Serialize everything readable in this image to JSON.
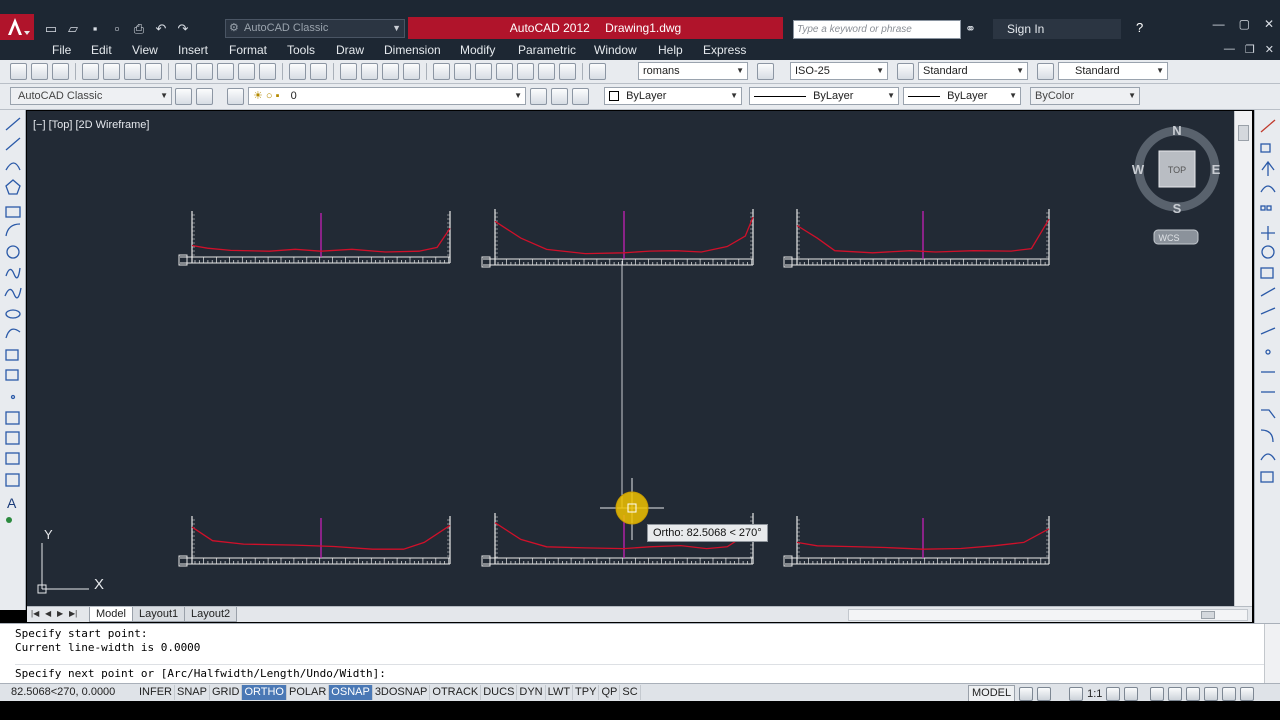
{
  "app": {
    "title_app": "AutoCAD 2012",
    "title_file": "Drawing1.dwg",
    "workspace": "AutoCAD Classic",
    "search_placeholder": "Type a keyword or phrase",
    "sign_in": "Sign In"
  },
  "menu": [
    "File",
    "Edit",
    "View",
    "Insert",
    "Format",
    "Tools",
    "Draw",
    "Dimension",
    "Modify",
    "Parametric",
    "Window",
    "Help",
    "Express"
  ],
  "toolbar1": {
    "text_style": "romans",
    "dim_style": "ISO-25",
    "table_style": "Standard",
    "mleader_style": "Standard"
  },
  "toolbar2": {
    "workspace": "AutoCAD Classic",
    "layer": "0",
    "color": "ByLayer",
    "linetype": "ByLayer",
    "lineweight": "ByLayer",
    "plotstyle": "ByColor"
  },
  "viewport": {
    "label": "[−] [Top] [2D Wireframe]"
  },
  "viewcube": {
    "north": "N",
    "south": "S",
    "east": "E",
    "west": "W",
    "face": "TOP",
    "ucs": "WCS"
  },
  "ucs_icon": {
    "x": "X",
    "y": "Y"
  },
  "tooltip": "Ortho: 82.5068 < 270°",
  "tabs": [
    "Model",
    "Layout1",
    "Layout2"
  ],
  "command": {
    "history": [
      "Specify start point:",
      "Current line-width is 0.0000"
    ],
    "prompt": "Specify next point or [Arc/Halfwidth/Length/Undo/Width]:"
  },
  "status": {
    "coords": "82.5068<270, 0.0000",
    "toggles": [
      {
        "label": "INFER",
        "on": false
      },
      {
        "label": "SNAP",
        "on": false
      },
      {
        "label": "GRID",
        "on": false
      },
      {
        "label": "ORTHO",
        "on": true
      },
      {
        "label": "POLAR",
        "on": false
      },
      {
        "label": "OSNAP",
        "on": true
      },
      {
        "label": "3DOSNAP",
        "on": false
      },
      {
        "label": "OTRACK",
        "on": false
      },
      {
        "label": "DUCS",
        "on": false
      },
      {
        "label": "DYN",
        "on": false
      },
      {
        "label": "LWT",
        "on": false
      },
      {
        "label": "TPY",
        "on": false
      },
      {
        "label": "QP",
        "on": false
      },
      {
        "label": "SC",
        "on": false
      }
    ],
    "model": "MODEL",
    "scale": "1:1"
  },
  "colors": {
    "drawing_bg": "#222a35",
    "profile_red": "#d0102a",
    "center_magenta": "#d01fc0",
    "frame_white": "#e8e8e8",
    "cursor_yellow": "#f0c200",
    "title_red": "#b0142b",
    "toggle_on": "#4a78b5"
  }
}
